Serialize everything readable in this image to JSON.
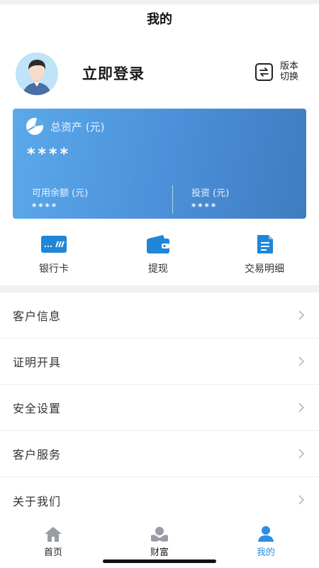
{
  "header": {
    "title": "我的"
  },
  "profile": {
    "login_label": "立即登录",
    "switch_label": "版本切换"
  },
  "assets": {
    "total_label": "总资产 (元)",
    "total_value": "****",
    "available_label": "可用余额 (元)",
    "available_value": "****",
    "invest_label": "投资 (元)",
    "invest_value": "****"
  },
  "quick_actions": [
    {
      "label": "银行卡",
      "icon": "bank-card-icon"
    },
    {
      "label": "提现",
      "icon": "wallet-icon"
    },
    {
      "label": "交易明细",
      "icon": "document-icon"
    }
  ],
  "menu": [
    {
      "label": "客户信息"
    },
    {
      "label": "证明开具"
    },
    {
      "label": "安全设置"
    },
    {
      "label": "客户服务"
    },
    {
      "label": "关于我们"
    }
  ],
  "tabs": [
    {
      "label": "首页",
      "icon": "home-icon",
      "active": false
    },
    {
      "label": "财富",
      "icon": "wealth-icon",
      "active": false
    },
    {
      "label": "我的",
      "icon": "user-icon",
      "active": true
    }
  ],
  "colors": {
    "accent": "#2c8fe0",
    "card_start": "#5aa9ea",
    "card_end": "#3f7cc0"
  }
}
